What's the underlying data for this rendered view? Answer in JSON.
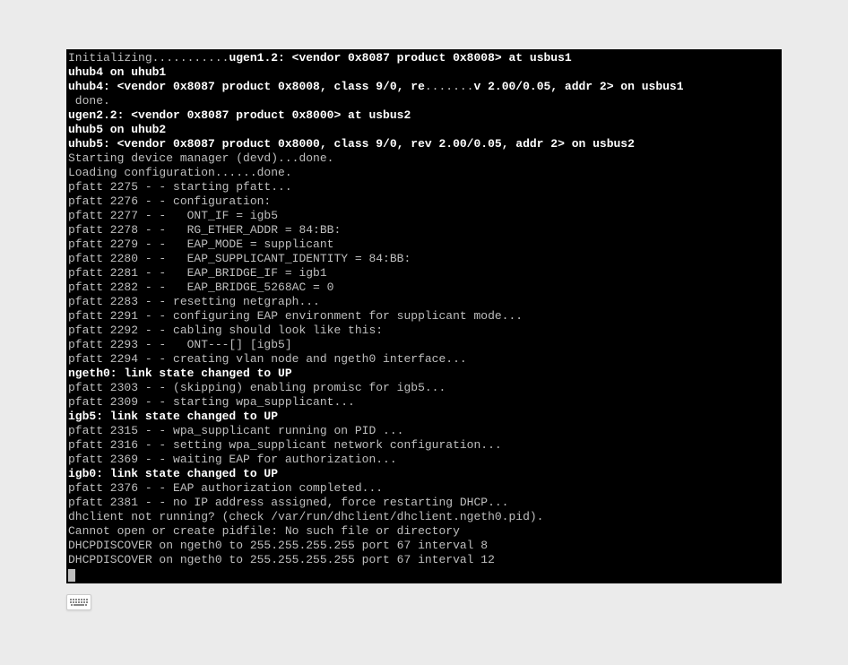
{
  "terminal": {
    "lines": [
      {
        "segments": [
          {
            "text": "Initializing...........",
            "bold": false
          },
          {
            "text": "ugen1.2: <vendor 0x8087 product 0x8008> at usbus1",
            "bold": true
          }
        ]
      },
      {
        "segments": [
          {
            "text": "uhub4 on uhub1",
            "bold": true
          }
        ]
      },
      {
        "segments": [
          {
            "text": "uhub4: <vendor 0x8087 product 0x8008, class 9/0, re",
            "bold": true
          },
          {
            "text": ".......",
            "bold": false
          },
          {
            "text": "v 2.00/0.05, addr 2> on usbus1",
            "bold": true
          }
        ]
      },
      {
        "segments": [
          {
            "text": " done.",
            "bold": false
          }
        ]
      },
      {
        "segments": [
          {
            "text": "ugen2.2: <vendor 0x8087 product 0x8000> at usbus2",
            "bold": true
          }
        ]
      },
      {
        "segments": [
          {
            "text": "uhub5 on uhub2",
            "bold": true
          }
        ]
      },
      {
        "segments": [
          {
            "text": "uhub5: <vendor 0x8087 product 0x8000, class 9/0, rev 2.00/0.05, addr 2> on usbus2",
            "bold": true
          }
        ]
      },
      {
        "segments": [
          {
            "text": "Starting device manager (devd)...done.",
            "bold": false
          }
        ]
      },
      {
        "segments": [
          {
            "text": "Loading configuration......done.",
            "bold": false
          }
        ]
      },
      {
        "segments": [
          {
            "text": "pfatt 2275 - - starting pfatt...",
            "bold": false
          }
        ]
      },
      {
        "segments": [
          {
            "text": "pfatt 2276 - - configuration:",
            "bold": false
          }
        ]
      },
      {
        "segments": [
          {
            "text": "pfatt 2277 - -   ONT_IF = igb5",
            "bold": false
          }
        ]
      },
      {
        "segments": [
          {
            "text": "pfatt 2278 - -   RG_ETHER_ADDR = 84:BB:",
            "bold": false
          }
        ]
      },
      {
        "segments": [
          {
            "text": "pfatt 2279 - -   EAP_MODE = supplicant",
            "bold": false
          }
        ]
      },
      {
        "segments": [
          {
            "text": "pfatt 2280 - -   EAP_SUPPLICANT_IDENTITY = 84:BB:",
            "bold": false
          }
        ]
      },
      {
        "segments": [
          {
            "text": "pfatt 2281 - -   EAP_BRIDGE_IF = igb1",
            "bold": false
          }
        ]
      },
      {
        "segments": [
          {
            "text": "pfatt 2282 - -   EAP_BRIDGE_5268AC = 0",
            "bold": false
          }
        ]
      },
      {
        "segments": [
          {
            "text": "pfatt 2283 - - resetting netgraph...",
            "bold": false
          }
        ]
      },
      {
        "segments": [
          {
            "text": "pfatt 2291 - - configuring EAP environment for supplicant mode...",
            "bold": false
          }
        ]
      },
      {
        "segments": [
          {
            "text": "pfatt 2292 - - cabling should look like this:",
            "bold": false
          }
        ]
      },
      {
        "segments": [
          {
            "text": "pfatt 2293 - -   ONT---[] [igb5]",
            "bold": false
          }
        ]
      },
      {
        "segments": [
          {
            "text": "pfatt 2294 - - creating vlan node and ngeth0 interface...",
            "bold": false
          }
        ]
      },
      {
        "segments": [
          {
            "text": "ngeth0: link state changed to UP",
            "bold": true
          }
        ]
      },
      {
        "segments": [
          {
            "text": "pfatt 2303 - - (skipping) enabling promisc for igb5...",
            "bold": false
          }
        ]
      },
      {
        "segments": [
          {
            "text": "pfatt 2309 - - starting wpa_supplicant...",
            "bold": false
          }
        ]
      },
      {
        "segments": [
          {
            "text": "igb5: link state changed to UP",
            "bold": true
          }
        ]
      },
      {
        "segments": [
          {
            "text": "pfatt 2315 - - wpa_supplicant running on PID ...",
            "bold": false
          }
        ]
      },
      {
        "segments": [
          {
            "text": "pfatt 2316 - - setting wpa_supplicant network configuration...",
            "bold": false
          }
        ]
      },
      {
        "segments": [
          {
            "text": "pfatt 2369 - - waiting EAP for authorization...",
            "bold": false
          }
        ]
      },
      {
        "segments": [
          {
            "text": "igb0: link state changed to UP",
            "bold": true
          }
        ]
      },
      {
        "segments": [
          {
            "text": "pfatt 2376 - - EAP authorization completed...",
            "bold": false
          }
        ]
      },
      {
        "segments": [
          {
            "text": "pfatt 2381 - - no IP address assigned, force restarting DHCP...",
            "bold": false
          }
        ]
      },
      {
        "segments": [
          {
            "text": "dhclient not running? (check /var/run/dhclient/dhclient.ngeth0.pid).",
            "bold": false
          }
        ]
      },
      {
        "segments": [
          {
            "text": "Cannot open or create pidfile: No such file or directory",
            "bold": false
          }
        ]
      },
      {
        "segments": [
          {
            "text": "DHCPDISCOVER on ngeth0 to 255.255.255.255 port 67 interval 8",
            "bold": false
          }
        ]
      },
      {
        "segments": [
          {
            "text": "DHCPDISCOVER on ngeth0 to 255.255.255.255 port 67 interval 12",
            "bold": false
          }
        ]
      }
    ]
  }
}
